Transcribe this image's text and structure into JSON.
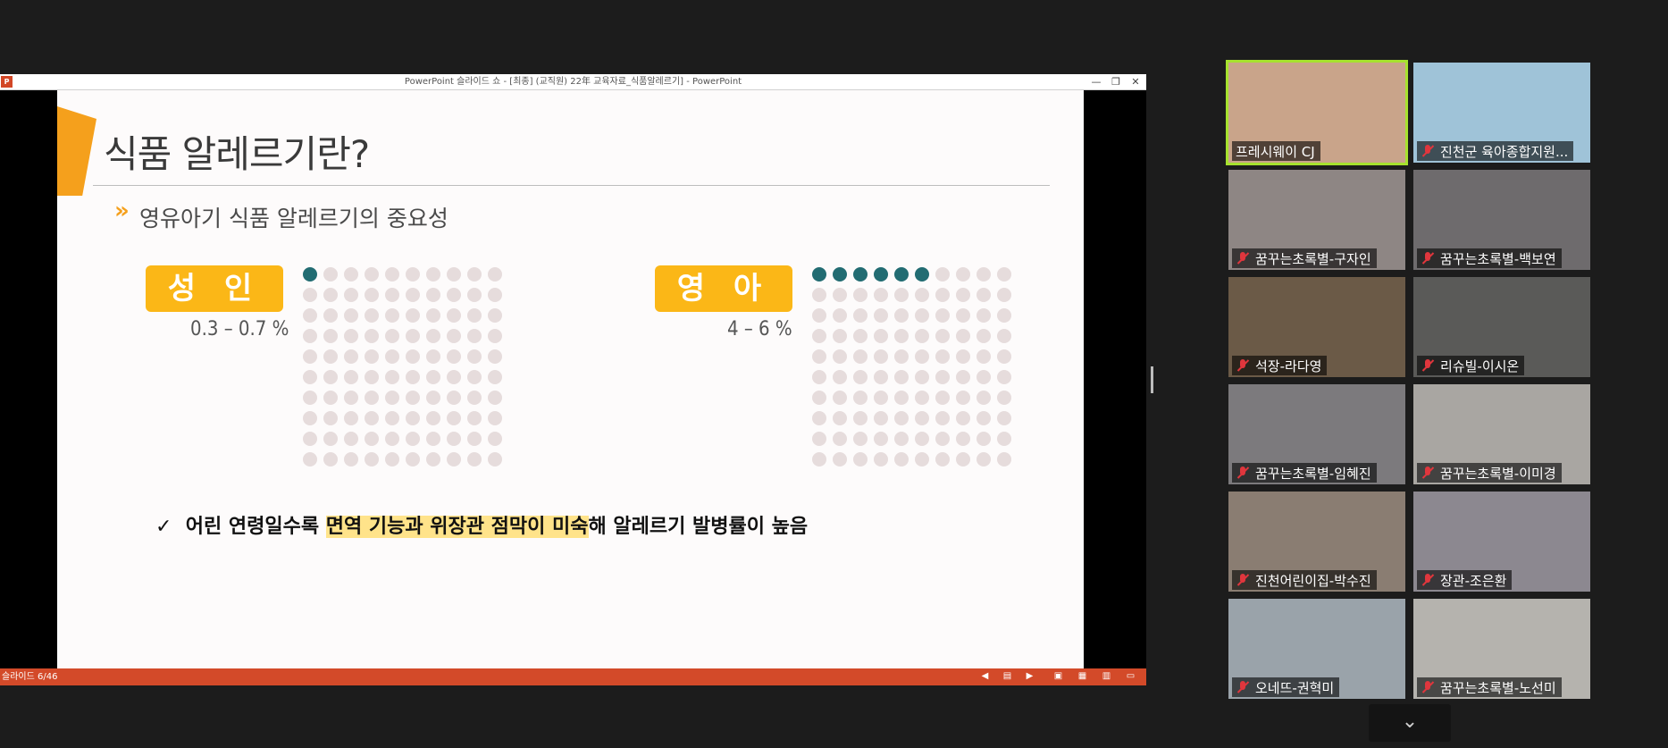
{
  "colors": {
    "accent": "#f5a01c",
    "badge": "#fbb717",
    "dot_on": "#226c72",
    "dot_off": "#e6dcdc",
    "highlight": "#ffe38a",
    "statusbar": "#d34a29",
    "active_speaker": "#a6e22e",
    "muted_mic": "#e0363d"
  },
  "ppt": {
    "window_title": "PowerPoint 슬라이드 쇼 - [최종] (교직원) 22年 교육자료_식품알레르기] - PowerPoint",
    "app_icon_label": "P",
    "controls": {
      "minimize": "—",
      "restore": "❐",
      "close": "✕"
    },
    "status": {
      "slide_counter": "슬라이드 6/46"
    }
  },
  "slide": {
    "title": "식품 알레르기란?",
    "bullet_icon": "»",
    "subtitle": "영유아기 식품 알레르기의 중요성",
    "groups": [
      {
        "label": "성 인",
        "rate": "0.3 – 0.7 %",
        "filled_dots": 1,
        "total_dots": 100
      },
      {
        "label": "영 아",
        "rate": "4 – 6 %",
        "filled_dots": 6,
        "total_dots": 100
      }
    ],
    "check_mark": "✓",
    "statement_pre": "어린 연령일수록 ",
    "statement_highlight": "면역 기능과 위장관 점막이 미숙",
    "statement_post": "해 알레르기 발병률이 높음"
  },
  "participants": [
    {
      "name": "프레시웨이 CJ",
      "active": true,
      "muted": false,
      "bg": "#c9a48a"
    },
    {
      "name": "진천군 육아종합지원...",
      "active": false,
      "muted": true,
      "bg": "#9fc3d8"
    },
    {
      "name": "꿈꾸는초록별-구자인",
      "active": false,
      "muted": true,
      "bg": "#8e8684"
    },
    {
      "name": "꿈꾸는초록별-백보연",
      "active": false,
      "muted": true,
      "bg": "#6e6b6d"
    },
    {
      "name": "석장-라다영",
      "active": false,
      "muted": true,
      "bg": "#6b5a47"
    },
    {
      "name": "리슈빌-이시온",
      "active": false,
      "muted": true,
      "bg": "#5a5a58"
    },
    {
      "name": "꿈꾸는초록별-임혜진",
      "active": false,
      "muted": true,
      "bg": "#7c7a7d"
    },
    {
      "name": "꿈꾸는초록별-이미경",
      "active": false,
      "muted": true,
      "bg": "#a9a6a2"
    },
    {
      "name": "진천어린이집-박수진",
      "active": false,
      "muted": true,
      "bg": "#8a7d72"
    },
    {
      "name": "장관-조은환",
      "active": false,
      "muted": true,
      "bg": "#8c8890"
    },
    {
      "name": "오네뜨-권혁미",
      "active": false,
      "muted": true,
      "bg": "#9aa3aa"
    },
    {
      "name": "꿈꾸는초록별-노선미",
      "active": false,
      "muted": true,
      "bg": "#b5b3ae"
    }
  ],
  "gallery": {
    "more_icon": "⌄"
  }
}
